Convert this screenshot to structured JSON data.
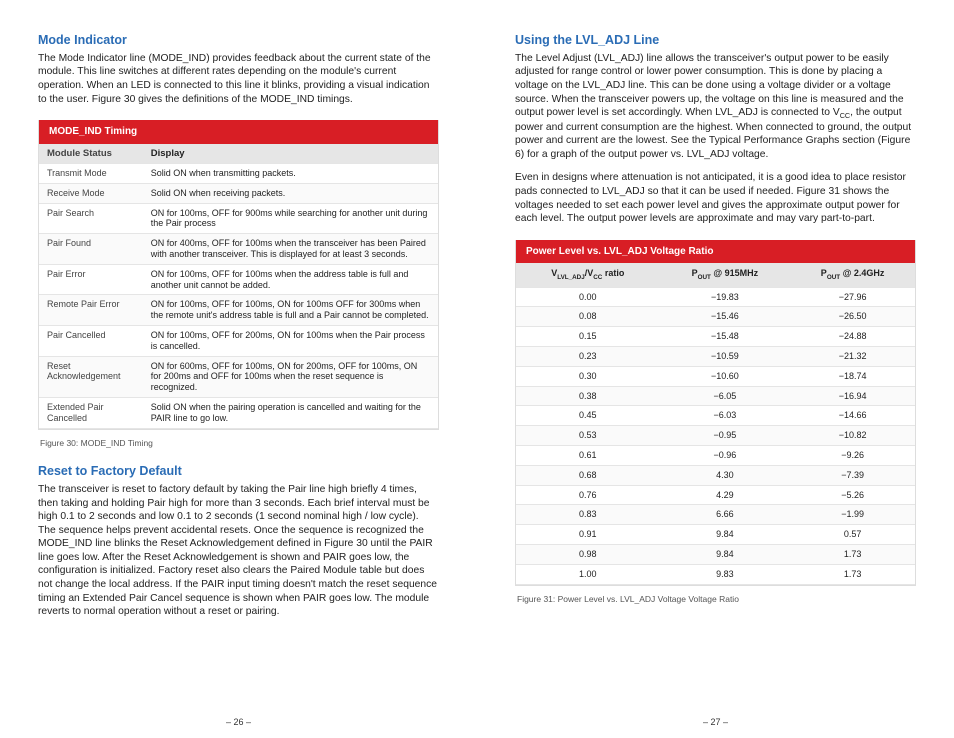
{
  "left": {
    "h1": "Mode Indicator",
    "p1": "The Mode Indicator line (MODE_IND) provides feedback about the current state of the module. This line switches at different rates depending on the module's current operation. When an LED is connected to this line it blinks, providing a visual indication to the user. Figure 30 gives the definitions of the MODE_IND timings.",
    "t1_title": "MODE_IND Timing",
    "t1_h1": "Module Status",
    "t1_h2": "Display",
    "rows1": [
      {
        "a": "Transmit Mode",
        "b": "Solid ON when transmitting packets."
      },
      {
        "a": "Receive Mode",
        "b": "Solid ON when receiving packets."
      },
      {
        "a": "Pair Search",
        "b": "ON for 100ms, OFF for 900ms while searching for another unit during the Pair process"
      },
      {
        "a": "Pair Found",
        "b": "ON for 400ms, OFF for 100ms when the transceiver has been Paired with another transceiver. This is displayed for at least 3 seconds."
      },
      {
        "a": "Pair Error",
        "b": "ON for 100ms, OFF for 100ms when the address table is full and another unit cannot be added."
      },
      {
        "a": "Remote Pair Error",
        "b": "ON for 100ms, OFF for 100ms, ON for 100ms OFF for 300ms when the remote unit's address table is full and a Pair cannot be completed."
      },
      {
        "a": "Pair Cancelled",
        "b": "ON for 100ms, OFF for 200ms, ON for 100ms when the Pair process is cancelled."
      },
      {
        "a": "Reset Acknowledgement",
        "b": "ON for 600ms, OFF for 100ms, ON for 200ms, OFF for 100ms, ON for 200ms and OFF for 100ms when the reset sequence is recognized."
      },
      {
        "a": "Extended Pair Cancelled",
        "b": "Solid ON when the pairing operation is cancelled and waiting for the PAIR line to go low."
      }
    ],
    "cap1": "Figure 30: MODE_IND Timing",
    "h2": "Reset to Factory Default",
    "p2": "The transceiver is reset to factory default by taking the Pair line high briefly 4 times, then taking and holding Pair high for more than 3 seconds. Each brief interval must be high 0.1 to 2 seconds and low 0.1 to 2 seconds (1 second nominal high / low cycle). The sequence helps prevent accidental resets. Once the sequence is recognized the MODE_IND line blinks the Reset Acknowledgement defined in Figure 30 until the PAIR line goes low. After the Reset Acknowledgement is shown and PAIR goes low, the configuration is initialized. Factory reset also clears the Paired Module table but does not change the local address. If the PAIR input timing doesn't match the reset sequence timing an Extended Pair Cancel sequence is shown when PAIR goes low. The module reverts to normal operation without a reset or pairing.",
    "page": "– 26 –"
  },
  "right": {
    "h1": "Using the LVL_ADJ Line",
    "p1a": "The Level Adjust (LVL_ADJ) line allows the transceiver's output power to be easily adjusted for range control or lower power consumption. This is done by placing a voltage on the LVL_ADJ line. This can be done using a voltage divider or a voltage source. When the transceiver powers up, the voltage on this line is measured and the output power level is set accordingly. When LVL_ADJ is connected to V",
    "p1b": ", the output power and current consumption are the highest. When connected to ground, the output power and current are the lowest. See the Typical Performance Graphs section (Figure 6) for a graph of the output power vs. LVL_ADJ voltage.",
    "p2": "Even in designs where attenuation is not anticipated, it is a good idea to place resistor pads connected to LVL_ADJ so that it can be used if needed. Figure 31 shows the voltages needed to set each power level and gives the approximate output power for each level. The output power levels are approximate and may vary part-to-part.",
    "t2_title": "Power Level vs. LVL_ADJ Voltage Ratio",
    "t2_h1a": "V",
    "t2_h1b": "/V",
    "t2_h1c": " ratio",
    "t2_h2a": "P",
    "t2_h2b": " @ 915MHz",
    "t2_h3a": "P",
    "t2_h3b": " @ 2.4GHz",
    "rows2": [
      {
        "r": "0.00",
        "a": "−19.83",
        "b": "−27.96"
      },
      {
        "r": "0.08",
        "a": "−15.46",
        "b": "−26.50"
      },
      {
        "r": "0.15",
        "a": "−15.48",
        "b": "−24.88"
      },
      {
        "r": "0.23",
        "a": "−10.59",
        "b": "−21.32"
      },
      {
        "r": "0.30",
        "a": "−10.60",
        "b": "−18.74"
      },
      {
        "r": "0.38",
        "a": "−6.05",
        "b": "−16.94"
      },
      {
        "r": "0.45",
        "a": "−6.03",
        "b": "−14.66"
      },
      {
        "r": "0.53",
        "a": "−0.95",
        "b": "−10.82"
      },
      {
        "r": "0.61",
        "a": "−0.96",
        "b": "−9.26"
      },
      {
        "r": "0.68",
        "a": "4.30",
        "b": "−7.39"
      },
      {
        "r": "0.76",
        "a": "4.29",
        "b": "−5.26"
      },
      {
        "r": "0.83",
        "a": "6.66",
        "b": "−1.99"
      },
      {
        "r": "0.91",
        "a": "9.84",
        "b": "0.57"
      },
      {
        "r": "0.98",
        "a": "9.84",
        "b": "1.73"
      },
      {
        "r": "1.00",
        "a": "9.83",
        "b": "1.73"
      }
    ],
    "cap2": "Figure 31: Power Level vs. LVL_ADJ Voltage Voltage Ratio",
    "page": "– 27 –",
    "sub": {
      "cc": "CC",
      "lvl": "LVL_ADJ",
      "out": "OUT"
    }
  }
}
